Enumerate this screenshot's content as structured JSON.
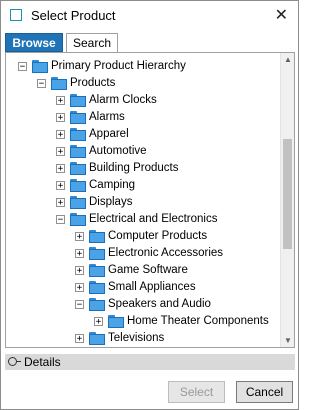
{
  "window": {
    "title": "Select Product",
    "close_glyph": "✕"
  },
  "tabs": [
    {
      "label": "Browse",
      "active": true
    },
    {
      "label": "Search",
      "active": false
    }
  ],
  "tree": [
    {
      "label": "Primary Product Hierarchy",
      "level": 0,
      "expanded": true
    },
    {
      "label": "Products",
      "level": 1,
      "expanded": true
    },
    {
      "label": "Alarm Clocks",
      "level": 2,
      "expanded": false
    },
    {
      "label": "Alarms",
      "level": 2,
      "expanded": false
    },
    {
      "label": "Apparel",
      "level": 2,
      "expanded": false
    },
    {
      "label": "Automotive",
      "level": 2,
      "expanded": false
    },
    {
      "label": "Building Products",
      "level": 2,
      "expanded": false
    },
    {
      "label": "Camping",
      "level": 2,
      "expanded": false
    },
    {
      "label": "Displays",
      "level": 2,
      "expanded": false
    },
    {
      "label": "Electrical and Electronics",
      "level": 2,
      "expanded": true
    },
    {
      "label": "Computer Products",
      "level": 3,
      "expanded": false
    },
    {
      "label": "Electronic Accessories",
      "level": 3,
      "expanded": false
    },
    {
      "label": "Game Software",
      "level": 3,
      "expanded": false
    },
    {
      "label": "Small Appliances",
      "level": 3,
      "expanded": false
    },
    {
      "label": "Speakers and Audio",
      "level": 3,
      "expanded": true
    },
    {
      "label": "Home Theater Components",
      "level": 4,
      "expanded": false
    },
    {
      "label": "Televisions",
      "level": 3,
      "expanded": false
    }
  ],
  "details": {
    "label": "Details"
  },
  "buttons": {
    "select": "Select",
    "cancel": "Cancel",
    "select_enabled": false
  },
  "icons": {
    "folder": "folder-icon",
    "expander_collapsed": "+",
    "expander_expanded": "−"
  },
  "colors": {
    "accent": "#1f73b7",
    "folder": "#4aa3e6",
    "details_bar": "#d9d9d9"
  }
}
